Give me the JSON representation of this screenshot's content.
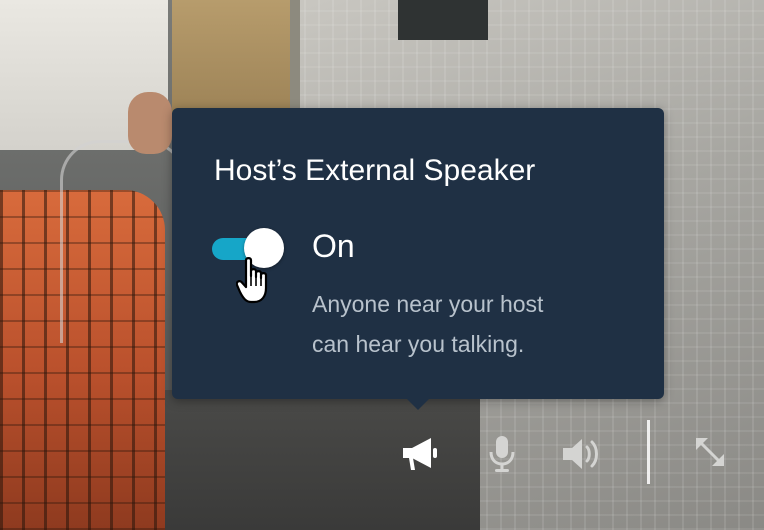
{
  "popover": {
    "title": "Host’s External Speaker",
    "toggle": {
      "state": "On",
      "is_on": true
    },
    "description_line1": "Anyone near your host",
    "description_line2": "can hear you talking."
  },
  "controls": [
    {
      "name": "external-speaker",
      "icon": "megaphone-icon"
    },
    {
      "name": "microphone",
      "icon": "microphone-icon"
    },
    {
      "name": "volume",
      "icon": "speaker-volume-icon"
    },
    {
      "name": "fullscreen",
      "icon": "expand-arrows-icon"
    }
  ],
  "colors": {
    "popover_bg": "#1f3044",
    "toggle_on": "#16a6c8",
    "text_primary": "#ffffff",
    "text_secondary": "#b8c2cc"
  }
}
